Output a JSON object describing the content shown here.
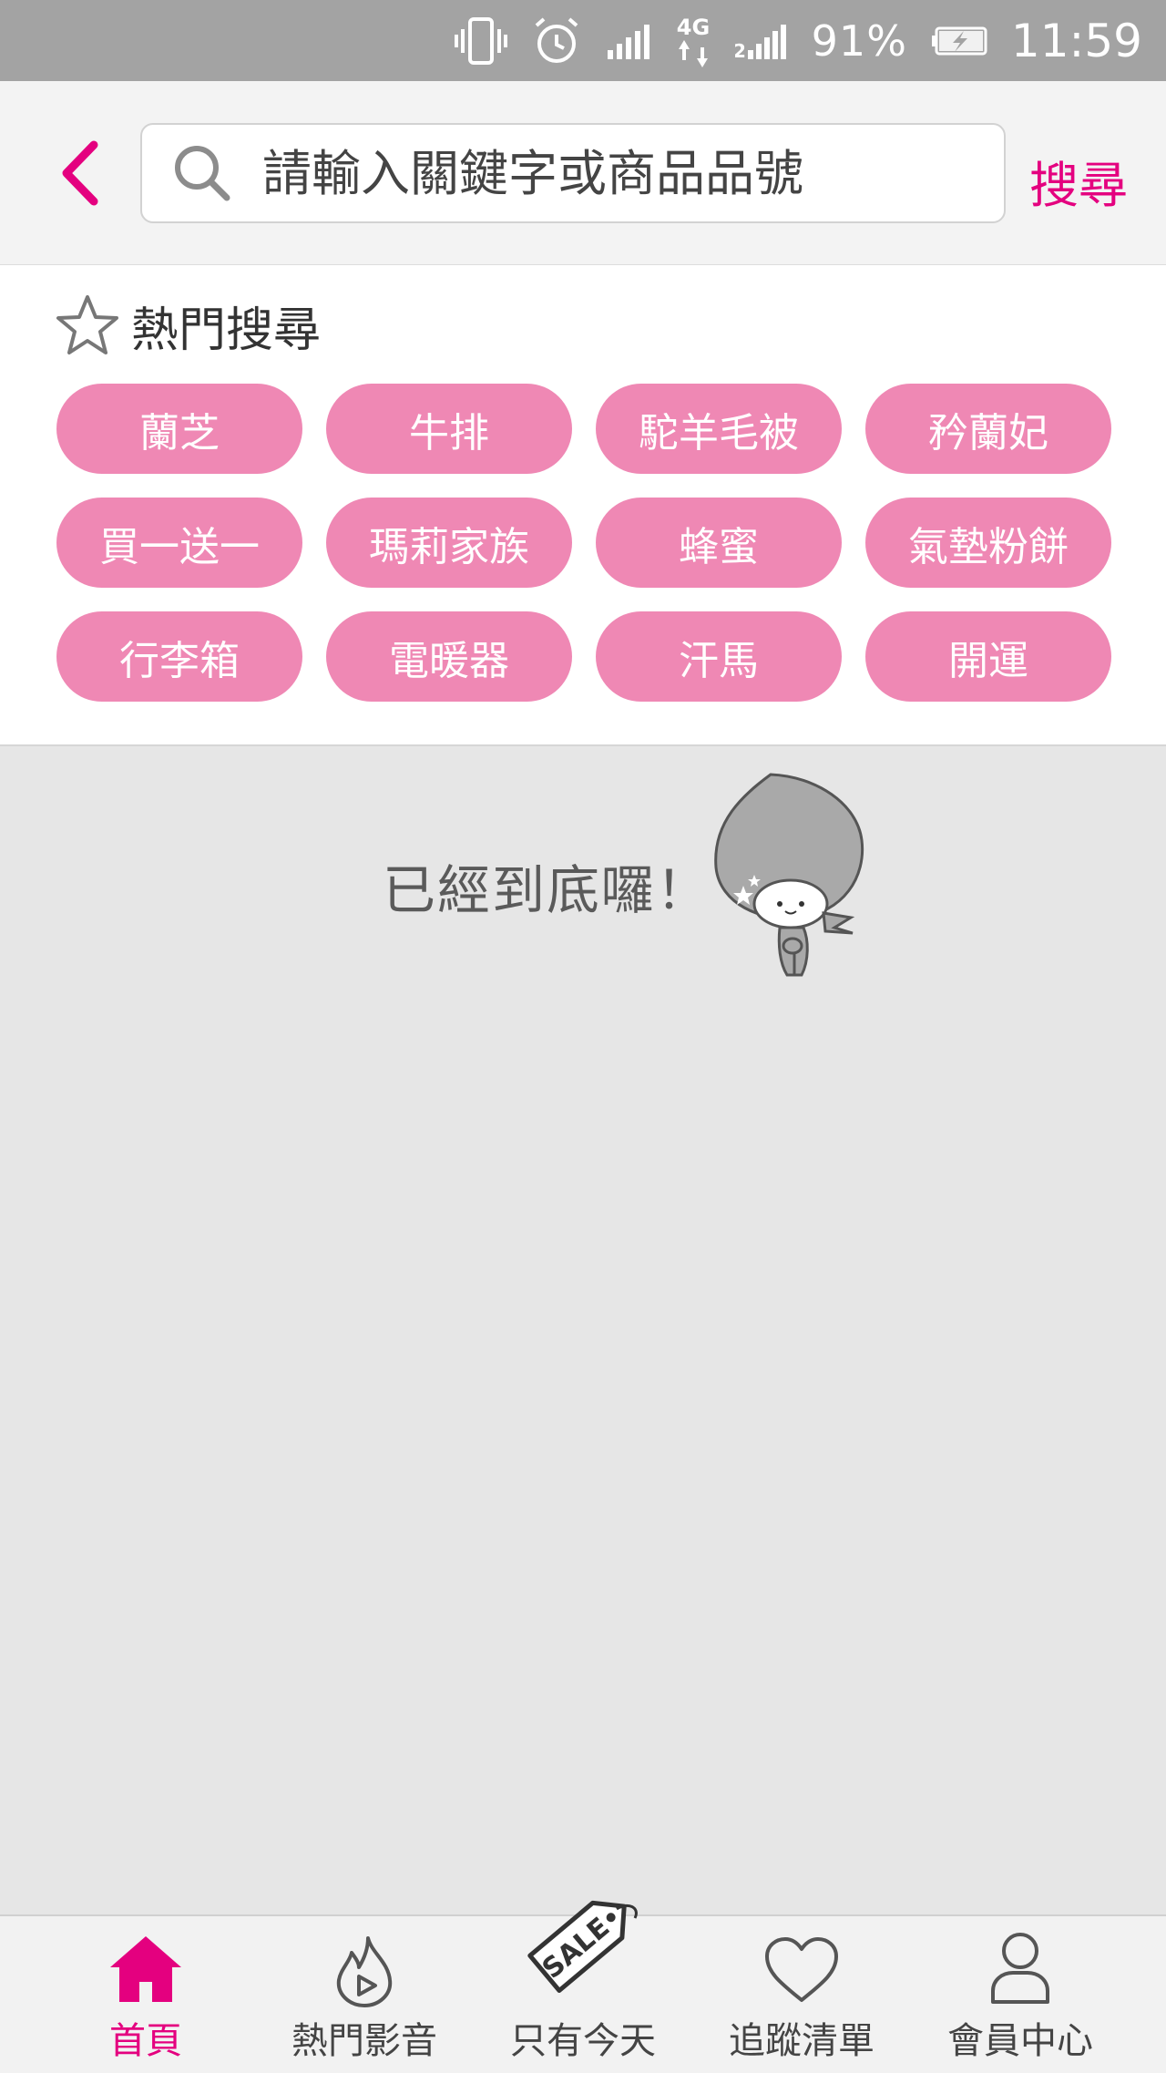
{
  "status_bar": {
    "network_type": "4G",
    "sim2_label": "2",
    "battery_percent": "91%",
    "time": "11:59"
  },
  "header": {
    "search_placeholder": "請輸入關鍵字或商品品號",
    "search_button": "搜尋"
  },
  "hot_searches": {
    "title": "熱門搜尋",
    "tags": [
      "蘭芝",
      "牛排",
      "駝羊毛被",
      "矜蘭妃",
      "買一送一",
      "瑪莉家族",
      "蜂蜜",
      "氣墊粉餅",
      "行李箱",
      "電暖器",
      "汗馬",
      "開運"
    ]
  },
  "end_notice": {
    "text": "已經到底囉！"
  },
  "bottom_nav": {
    "items": [
      {
        "label": "首頁",
        "icon": "home-icon",
        "active": true
      },
      {
        "label": "熱門影音",
        "icon": "flame-play-icon",
        "active": false
      },
      {
        "label": "只有今天",
        "icon": "sale-tag-icon",
        "active": false
      },
      {
        "label": "追蹤清單",
        "icon": "heart-icon",
        "active": false
      },
      {
        "label": "會員中心",
        "icon": "user-icon",
        "active": false
      }
    ],
    "sale_tag_text": "SALE"
  },
  "colors": {
    "accent": "#e4007f",
    "tag_bg": "#ef88b4",
    "status_bar_bg": "#a3a3a3",
    "page_bg": "#e6e6e6"
  }
}
